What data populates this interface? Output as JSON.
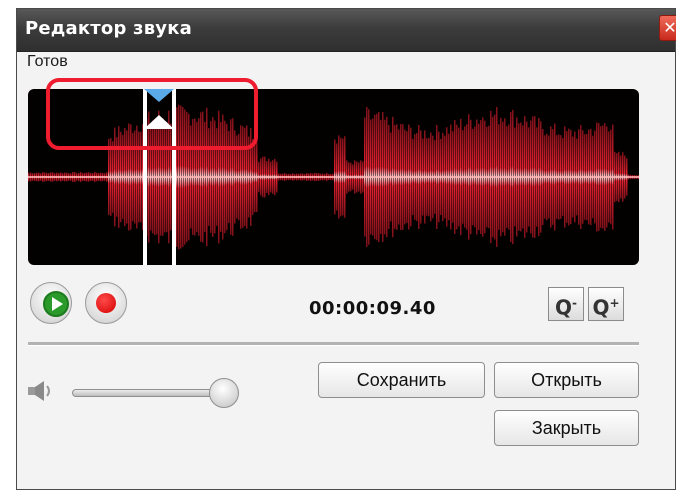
{
  "window": {
    "title": "Редактор звука",
    "close_glyph": "✕"
  },
  "status": {
    "text": "Готов"
  },
  "waveform": {
    "wave_color": "#e2202f",
    "background": "#030000",
    "selection_marker_color": "#5aa9e8"
  },
  "transport": {
    "play_icon": "play-icon",
    "record_icon": "record-icon",
    "time": "00:00:09.40"
  },
  "zoom": {
    "out_label": "Q",
    "out_sign": "-",
    "in_label": "Q",
    "in_sign": "+"
  },
  "volume": {
    "icon": "speaker-icon",
    "level": 1.0
  },
  "buttons": {
    "save": "Сохранить",
    "open": "Открыть",
    "close": "Закрыть"
  },
  "annotation": {
    "highlight_color": "#ee1c2e"
  }
}
